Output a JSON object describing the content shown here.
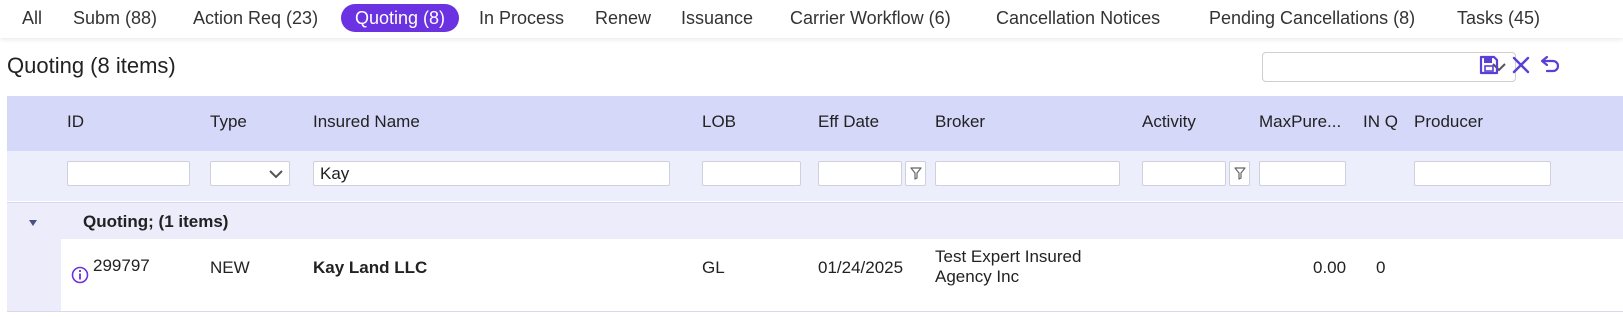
{
  "tabs": [
    {
      "label": "All"
    },
    {
      "label": "Subm (88)"
    },
    {
      "label": "Action Req (23)"
    },
    {
      "label": "Quoting (8)"
    },
    {
      "label": "In Process"
    },
    {
      "label": "Renew"
    },
    {
      "label": "Issuance"
    },
    {
      "label": "Carrier Workflow (6)"
    },
    {
      "label": "Cancellation Notices"
    },
    {
      "label": "Pending Cancellations (8)"
    },
    {
      "label": "Tasks (45)"
    }
  ],
  "active_tab": "Quoting (8)",
  "page_title": "Quoting (8 items)",
  "view_select": {
    "value": ""
  },
  "toolbar_icons": [
    "save-icon",
    "close-icon",
    "undo-icon"
  ],
  "columns": [
    "ID",
    "Type",
    "Insured Name",
    "LOB",
    "Eff Date",
    "Broker",
    "Activity",
    "MaxPure...",
    "IN Q",
    "Producer"
  ],
  "filters": {
    "id": "",
    "type": "",
    "insured_name": "Kay",
    "lob": "",
    "eff_date": "",
    "broker": "",
    "activity": "",
    "maxpure": "",
    "producer": ""
  },
  "group": {
    "label": "Quoting; (1 items)"
  },
  "rows": [
    {
      "id": "299797",
      "type": "NEW",
      "insured_name": "Kay Land LLC",
      "lob": "GL",
      "eff_date": "01/24/2025",
      "broker_line1": "Test Expert Insured",
      "broker_line2": "Agency Inc",
      "activity": "",
      "maxpure": "0.00",
      "in_q": "0",
      "producer": ""
    }
  ],
  "colors": {
    "accent": "#6a32e0",
    "header_bg": "#d6d8fa",
    "filter_bg": "#edeefc",
    "group_bg": "#ececfa",
    "icon": "#5b3fd6"
  }
}
